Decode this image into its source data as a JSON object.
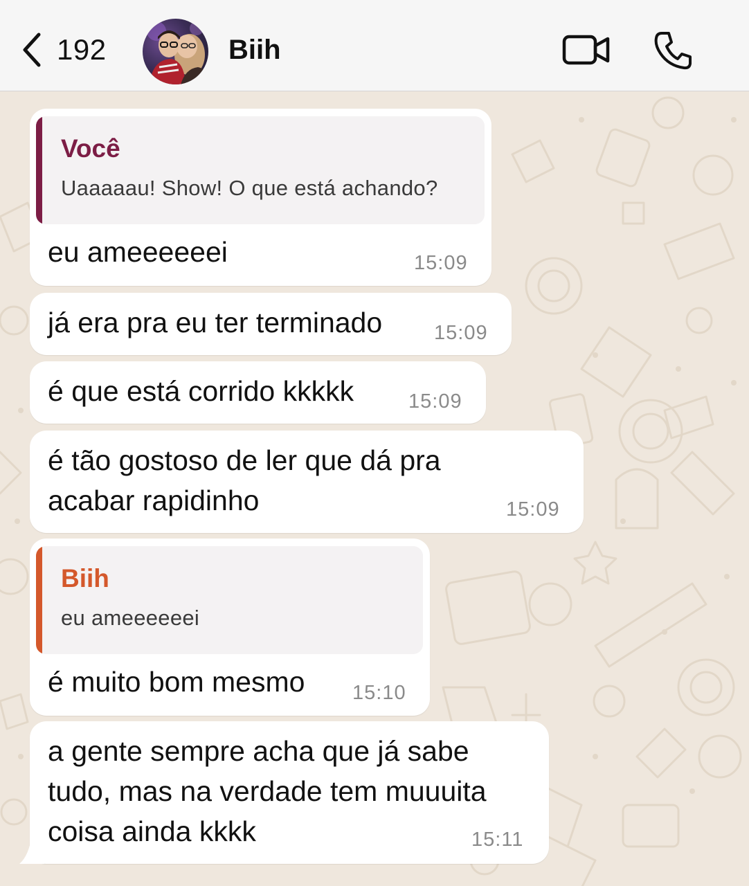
{
  "header": {
    "back_count": "192",
    "contact_name": "Biih",
    "icons": {
      "back": "chevron-left-icon",
      "video": "video-camera-icon",
      "call": "phone-icon"
    }
  },
  "colors": {
    "header_bg": "#f6f6f6",
    "chat_bg": "#efe7dd",
    "bubble_bg": "#ffffff",
    "quote_you": "#7c1d45",
    "quote_contact": "#d4582b",
    "time": "#8a8a8a"
  },
  "messages": [
    {
      "quote": {
        "author": "Você",
        "text": "Uaaaaau! Show! O que está achando?"
      },
      "text": "eu ameeeeeei",
      "time": "15:09"
    },
    {
      "text": "já era pra eu ter terminado",
      "time": "15:09"
    },
    {
      "text": "é que está corrido kkkkk",
      "time": "15:09"
    },
    {
      "text": "é tão gostoso de ler que dá pra\nacabar rapidinho",
      "time": "15:09"
    },
    {
      "quote": {
        "author": "Biih",
        "text": "eu ameeeeeei"
      },
      "text": "é muito bom mesmo",
      "time": "15:10"
    },
    {
      "text": "a gente sempre acha que já sabe\ntudo, mas na verdade tem muuuita\ncoisa ainda kkkk",
      "time": "15:11"
    }
  ]
}
